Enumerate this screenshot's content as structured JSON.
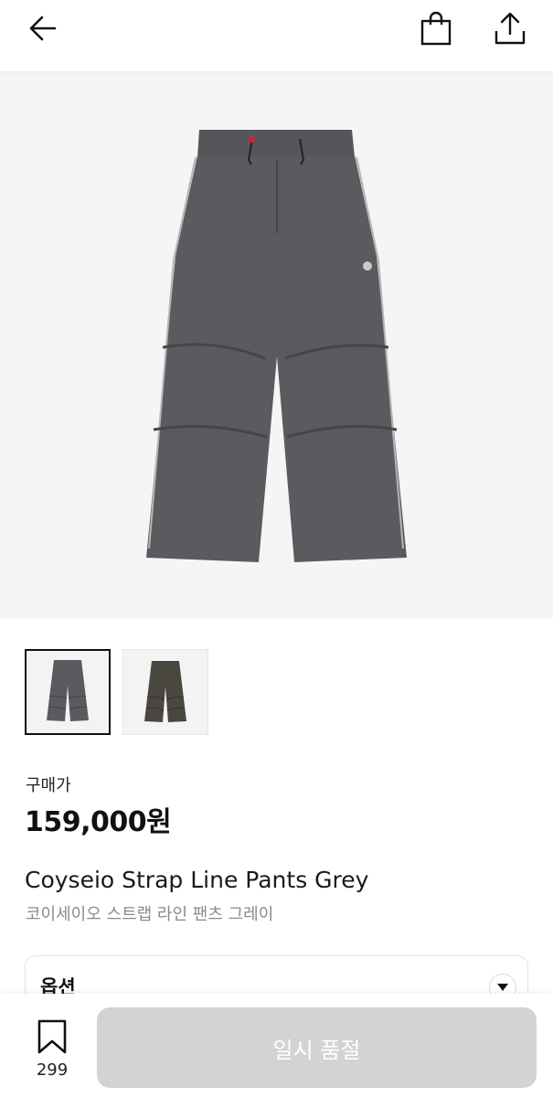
{
  "header": {
    "back_icon": "arrow-left-icon",
    "bag_icon": "shopping-bag-icon",
    "share_icon": "share-upload-icon"
  },
  "product": {
    "image_desc_icon": "pants-grey-photo",
    "thumbnails": [
      {
        "color": "#5a5b5f",
        "selected": true
      },
      {
        "color": "#4a4640",
        "selected": false
      }
    ],
    "price_label": "구매가",
    "price": "159,000원",
    "name_en": "Coyseio Strap Line Pants Grey",
    "name_ko": "코이세이오 스트랩 라인 팬츠 그레이"
  },
  "option": {
    "label": "옵션",
    "arrow_icon": "chevron-down-icon"
  },
  "bottom": {
    "bookmark_icon": "bookmark-icon",
    "bookmark_count": "299",
    "soldout_label": "일시 품절",
    "soldout_bg": "#d3d3d3"
  }
}
